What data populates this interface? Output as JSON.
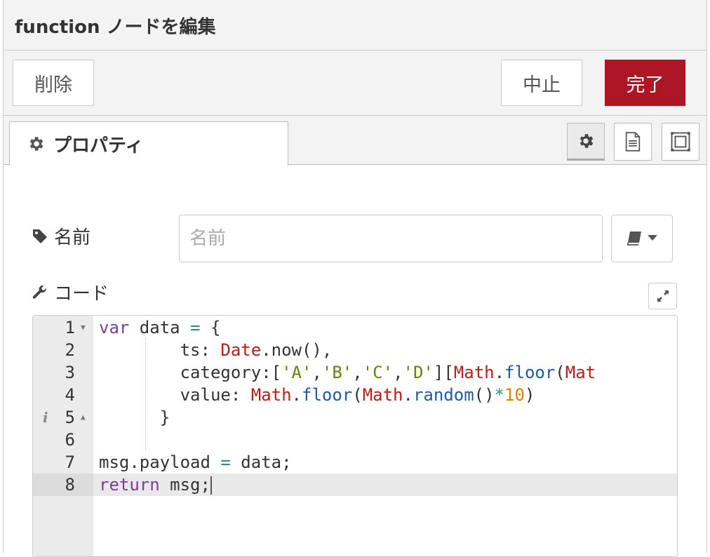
{
  "header": {
    "title": "function ノードを編集"
  },
  "toolbar": {
    "delete_label": "削除",
    "cancel_label": "中止",
    "done_label": "完了"
  },
  "tabs": {
    "properties_label": "プロパティ"
  },
  "colors": {
    "primary": "#ad1625",
    "panel": "#f3f3f3",
    "border": "#cccccc"
  },
  "form": {
    "name_label": "名前",
    "name_placeholder": "名前",
    "name_value": "",
    "code_label": "コード"
  },
  "icons": [
    "gear-icon",
    "description-icon",
    "appearance-icon",
    "tag-icon",
    "wrench-icon",
    "book-icon",
    "caret-down-icon",
    "expand-icon",
    "info-icon",
    "fold-icon"
  ],
  "editor": {
    "lines": [
      {
        "number": "1",
        "text": "var data = {"
      },
      {
        "number": "2",
        "text": "        ts: Date.now(),"
      },
      {
        "number": "3",
        "text": "        category:['A','B','C','D'][Math.floor(Mat"
      },
      {
        "number": "4",
        "text": "        value: Math.floor(Math.random()*10)"
      },
      {
        "number": "5",
        "text": "      }"
      },
      {
        "number": "6",
        "text": ""
      },
      {
        "number": "7",
        "text": "msg.payload = data;"
      },
      {
        "number": "8",
        "text": "return msg;"
      }
    ],
    "active_line": 8
  }
}
